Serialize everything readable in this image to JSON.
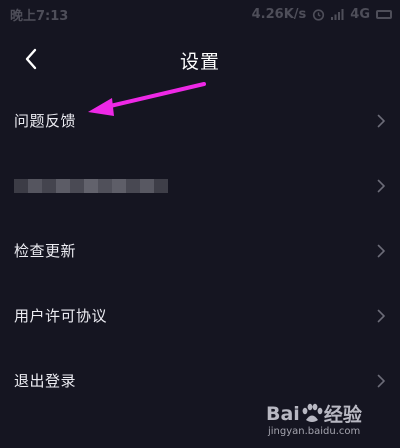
{
  "status_bar": {
    "time": "晚上7:13",
    "speed": "4.26K/s",
    "network": "4G"
  },
  "header": {
    "title": "设置",
    "back_icon": "chevron-left-icon"
  },
  "menu": {
    "items": [
      {
        "label": "问题反馈",
        "icon": "chevron-right-icon"
      },
      {
        "label": "",
        "icon": "chevron-right-icon",
        "redacted": true
      },
      {
        "label": "检查更新",
        "icon": "chevron-right-icon"
      },
      {
        "label": "用户许可协议",
        "icon": "chevron-right-icon"
      },
      {
        "label": "退出登录",
        "icon": "chevron-right-icon"
      }
    ]
  },
  "annotation": {
    "icon": "arrow-icon",
    "color": "#ee28e6"
  },
  "watermark": {
    "brand_left": "Bai",
    "brand_right": "经验",
    "url": "jingyan.baidu.com"
  },
  "colors": {
    "background": "#151521",
    "text": "#ececf2",
    "chevron": "#6c6c78",
    "status": "#4e4e59"
  }
}
